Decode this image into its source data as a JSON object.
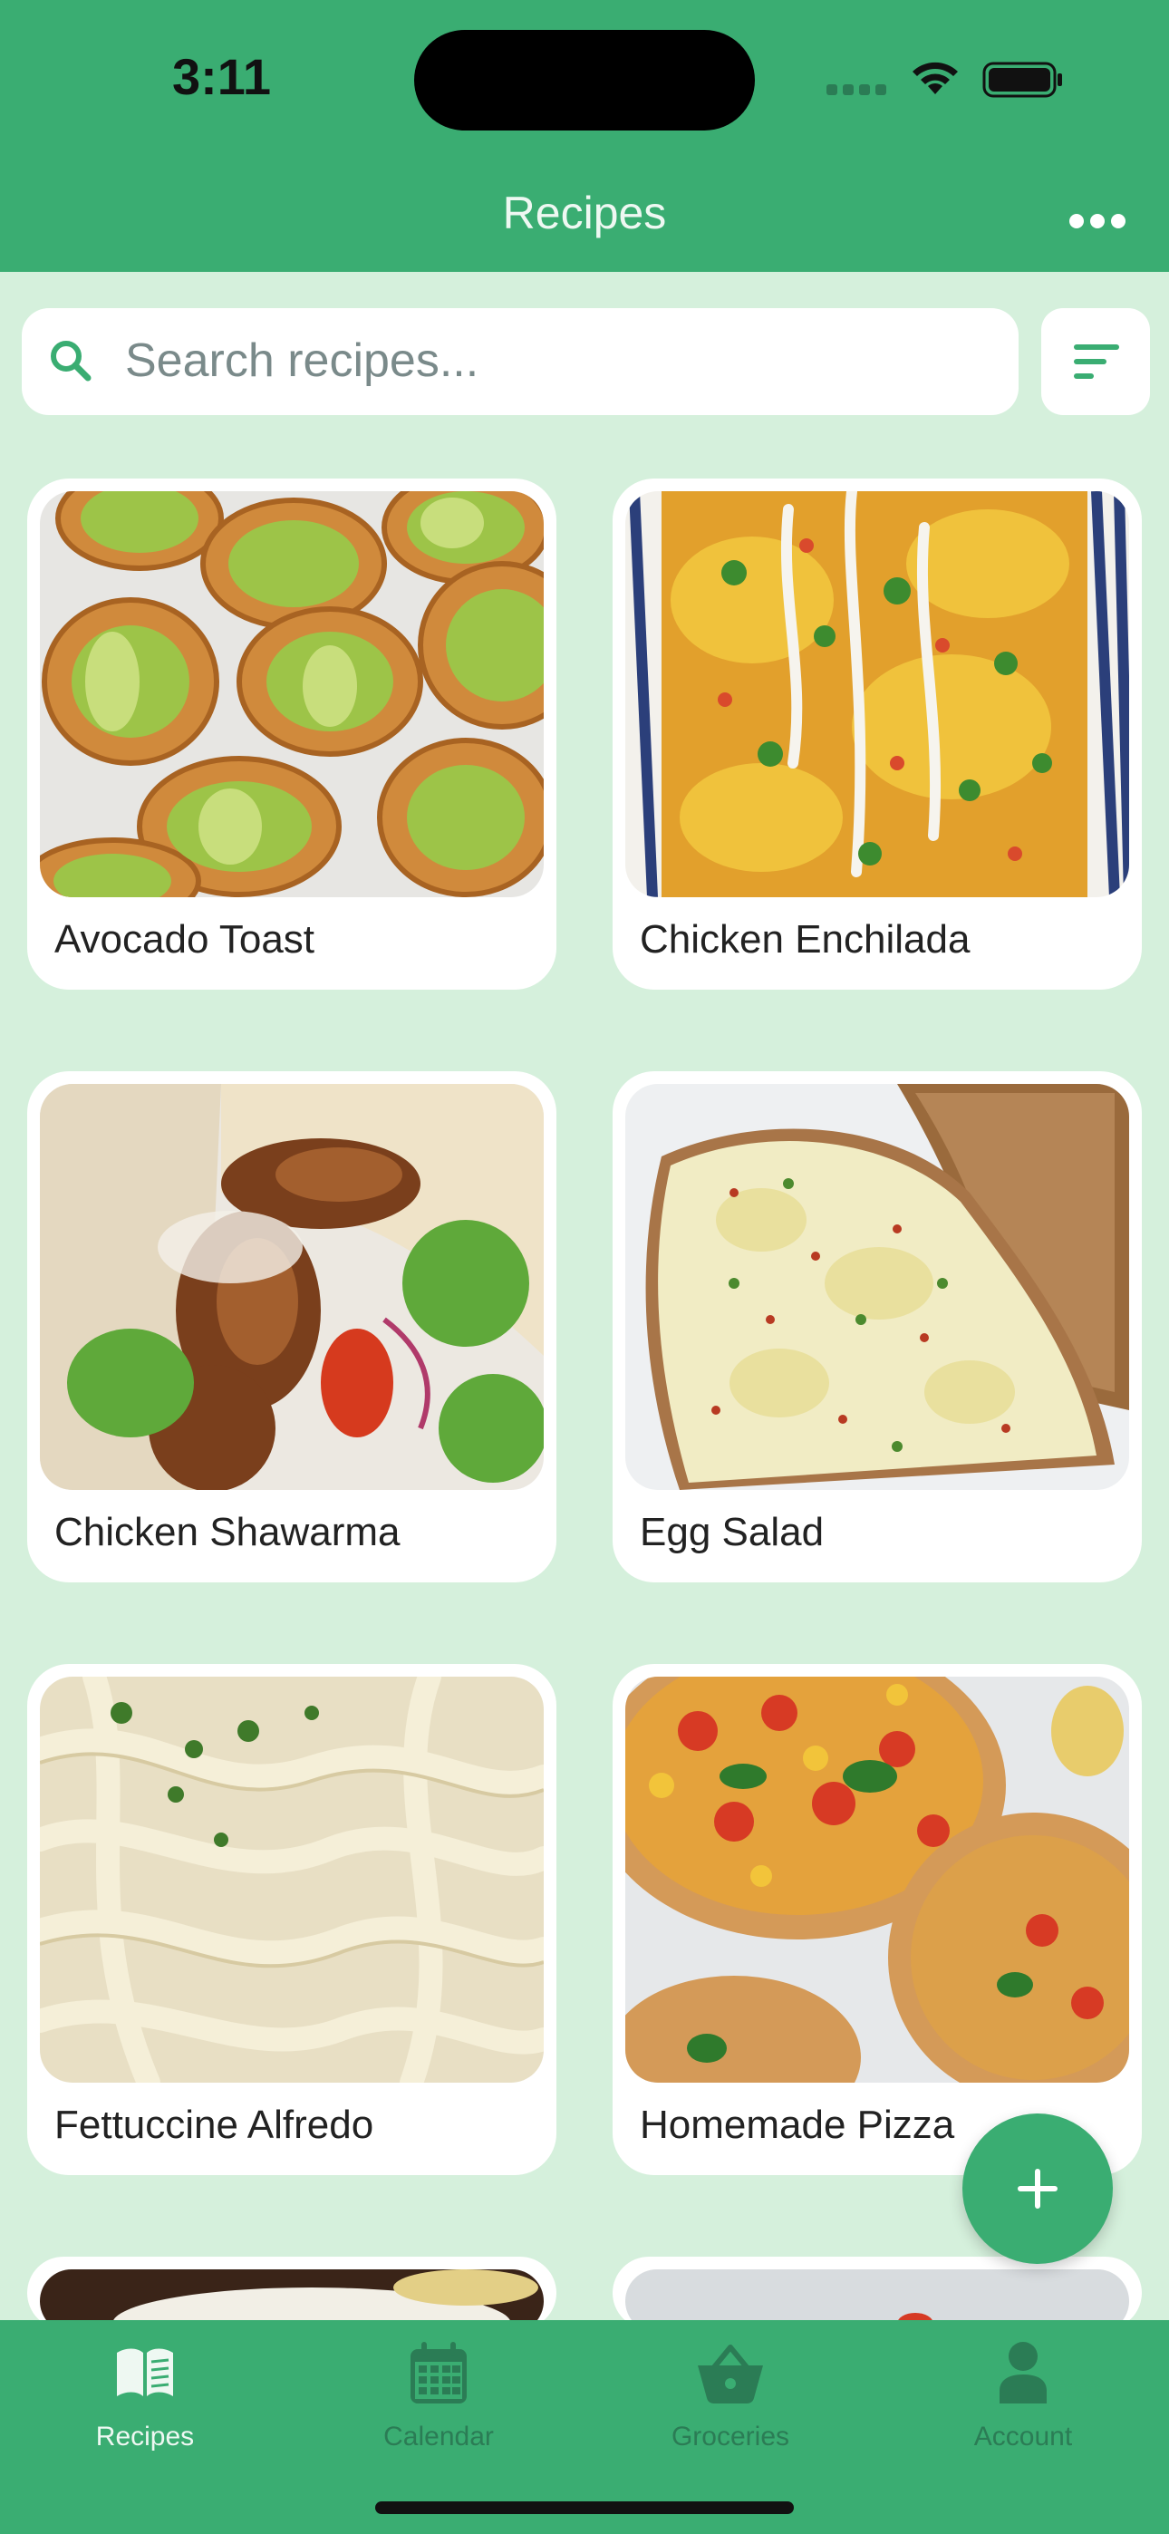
{
  "status_bar": {
    "time": "3:11"
  },
  "header": {
    "title": "Recipes",
    "menu_icon": "more-horizontal-icon"
  },
  "search": {
    "placeholder": "Search recipes...",
    "icon": "search-icon",
    "filter_icon": "sort-filter-icon"
  },
  "recipes": [
    {
      "title": "Avocado Toast"
    },
    {
      "title": "Chicken Enchilada"
    },
    {
      "title": "Chicken Shawarma"
    },
    {
      "title": "Egg Salad"
    },
    {
      "title": "Fettuccine Alfredo"
    },
    {
      "title": "Homemade Pizza"
    }
  ],
  "fab": {
    "icon": "plus-icon"
  },
  "tabs": [
    {
      "label": "Recipes",
      "icon": "book-icon",
      "active": true
    },
    {
      "label": "Calendar",
      "icon": "calendar-icon",
      "active": false
    },
    {
      "label": "Groceries",
      "icon": "basket-icon",
      "active": false
    },
    {
      "label": "Account",
      "icon": "person-icon",
      "active": false
    }
  ],
  "colors": {
    "brand": "#3aad72",
    "background": "#d5f0dc",
    "inactive_tab": "#2b7c55",
    "active_tab": "#eef8f2"
  }
}
